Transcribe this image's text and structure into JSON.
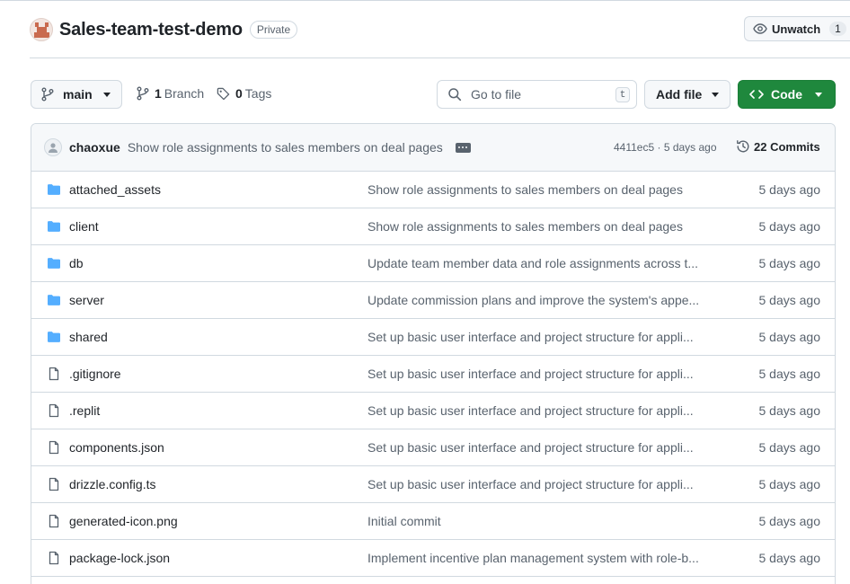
{
  "repo": {
    "name": "Sales-team-test-demo",
    "visibility": "Private",
    "watch_label": "Unwatch",
    "watch_count": "1"
  },
  "toolbar": {
    "branch": "main",
    "branch_count": "1",
    "branch_label": "Branch",
    "tag_count": "0",
    "tag_label": "Tags",
    "goto_placeholder": "Go to file",
    "goto_shortcut": "t",
    "add_file": "Add file",
    "code": "Code"
  },
  "commit": {
    "author": "chaoxue",
    "message": "Show role assignments to sales members on deal pages",
    "hash_time": "4411ec5 · 5 days ago",
    "commits_label": "22 Commits"
  },
  "files": [
    {
      "name": "attached_assets",
      "type": "folder",
      "message": "Show role assignments to sales members on deal pages",
      "time": "5 days ago"
    },
    {
      "name": "client",
      "type": "folder",
      "message": "Show role assignments to sales members on deal pages",
      "time": "5 days ago"
    },
    {
      "name": "db",
      "type": "folder",
      "message": "Update team member data and role assignments across t...",
      "time": "5 days ago"
    },
    {
      "name": "server",
      "type": "folder",
      "message": "Update commission plans and improve the system's appe...",
      "time": "5 days ago"
    },
    {
      "name": "shared",
      "type": "folder",
      "message": "Set up basic user interface and project structure for appli...",
      "time": "5 days ago"
    },
    {
      "name": ".gitignore",
      "type": "file",
      "message": "Set up basic user interface and project structure for appli...",
      "time": "5 days ago"
    },
    {
      "name": ".replit",
      "type": "file",
      "message": "Set up basic user interface and project structure for appli...",
      "time": "5 days ago"
    },
    {
      "name": "components.json",
      "type": "file",
      "message": "Set up basic user interface and project structure for appli...",
      "time": "5 days ago"
    },
    {
      "name": "drizzle.config.ts",
      "type": "file",
      "message": "Set up basic user interface and project structure for appli...",
      "time": "5 days ago"
    },
    {
      "name": "generated-icon.png",
      "type": "file",
      "message": "Initial commit",
      "time": "5 days ago"
    },
    {
      "name": "package-lock.json",
      "type": "file",
      "message": "Implement incentive plan management system with role-b...",
      "time": "5 days ago"
    }
  ],
  "colors": {
    "accent_green": "#1f883d",
    "folder_blue": "#54aeff",
    "muted_text": "#59636e",
    "border": "#d1d9e0"
  }
}
